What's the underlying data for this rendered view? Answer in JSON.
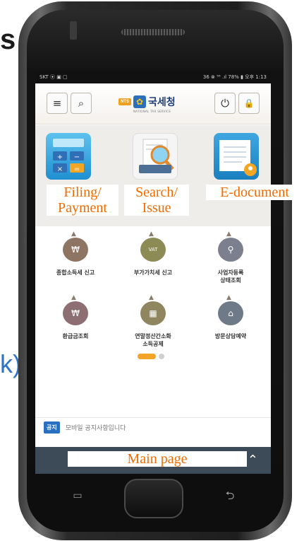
{
  "background": {
    "slide_text_top": "s",
    "slide_text_bottom": "k)"
  },
  "status_bar": {
    "left": "SKT ⦿ ▣ ▢",
    "right": "36 ⊗ ⁵⁵ .ıl 78% ▮ 오후 1:13"
  },
  "topbar": {
    "menu_icon": "≡",
    "search_icon": "⌕",
    "logo_badge": "NTS",
    "logo_title": "국세청",
    "logo_subtitle": "NATIONAL TAX SERVICE",
    "power_icon": "⏻",
    "lock_icon": "🔒"
  },
  "captions": {
    "filing": "Filing/\nPayment",
    "search": "Search/\nIssue",
    "edocument": "E-document",
    "main_page": "Main page"
  },
  "grid": [
    {
      "label": "종합소득세 신고",
      "icon": "money-bag-icon"
    },
    {
      "label": "부가가치세 신고",
      "icon": "vat-icon"
    },
    {
      "label": "사업자등록\n상태조회",
      "icon": "person-search-icon"
    },
    {
      "label": "환급금조회",
      "icon": "refund-icon"
    },
    {
      "label": "연말정산간소화\n소득공제",
      "icon": "calculator-icon"
    },
    {
      "label": "방문상담예약",
      "icon": "house-check-icon"
    }
  ],
  "notice": {
    "badge": "공지",
    "text": "모바일 공지사항입니다"
  },
  "nav": {
    "up": "⌃",
    "menu": "▭",
    "back": "⮌"
  }
}
